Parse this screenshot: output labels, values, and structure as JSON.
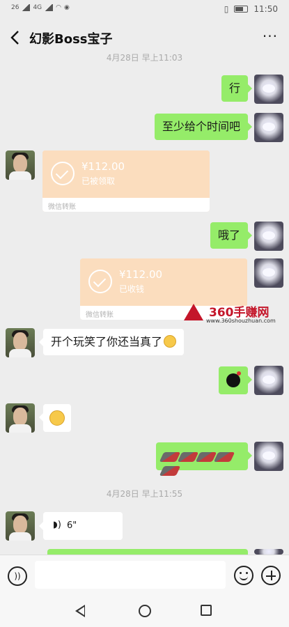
{
  "status_bar": {
    "signal_left": "26",
    "signal_right": "4G",
    "time": "11:50"
  },
  "header": {
    "title": "幻影Boss宝子",
    "more_label": "···"
  },
  "time_separators": {
    "first": "4月28日 早上11:03",
    "second": "4月28日 早上11:55"
  },
  "messages": {
    "m1": "行",
    "m2": "至少给个时间吧",
    "transfer1": {
      "amount": "¥112.00",
      "status": "已被领取",
      "footer": "微信转账"
    },
    "m3": "哦了",
    "transfer2": {
      "amount": "¥112.00",
      "status": "已收钱",
      "footer": "微信转账"
    },
    "m4": "开个玩笑了你还当真了",
    "voice": "6\""
  },
  "watermark": {
    "brand": "360手赚网",
    "url": "www.360shouzhuan.com"
  },
  "icons": {
    "back": "chevron-left-icon",
    "more": "more-dots-icon",
    "voice_input": "voice-icon",
    "emoji": "emoji-icon",
    "plus": "plus-icon"
  }
}
